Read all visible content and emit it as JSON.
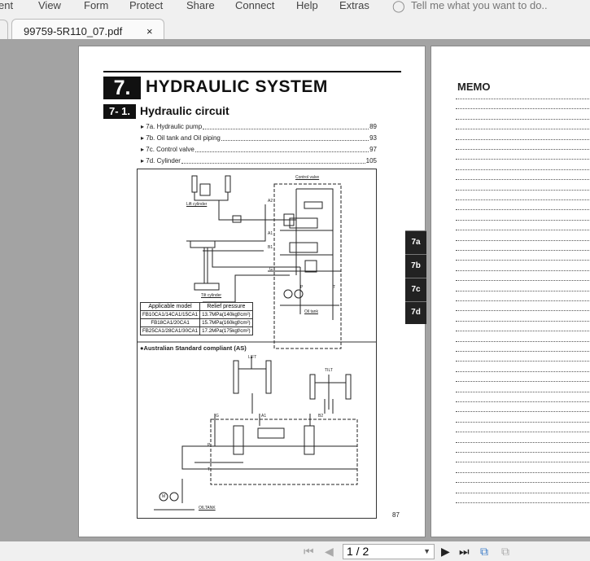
{
  "menubar": {
    "items": [
      "ent",
      "View",
      "Form",
      "Protect",
      "Share",
      "Connect",
      "Help",
      "Extras"
    ],
    "search_placeholder": "Tell me what you want to do.."
  },
  "tabs": [
    {
      "label": "99759-5R110_07.pdf",
      "close": "×"
    }
  ],
  "page1": {
    "chapter_number": "7.",
    "chapter_title": "HYDRAULIC SYSTEM",
    "section_number": "7- 1.",
    "section_title": "Hydraulic circuit",
    "toc": [
      {
        "label": "▸ 7a. Hydraulic pump",
        "page": "89"
      },
      {
        "label": "▸ 7b. Oil tank and Oil piping",
        "page": "93"
      },
      {
        "label": "▸ 7c. Control valve",
        "page": "97"
      },
      {
        "label": "▸ 7d. Cylinder",
        "page": "105"
      }
    ],
    "diagram": {
      "labels": {
        "control_valve": "Control valve",
        "lift_cylinder": "Lift cylinder",
        "tilt_cylinder": "Tilt cylinder",
        "oil_tank": "Oil tank",
        "a2": "A2",
        "a1": "A1",
        "b1": "B1",
        "g": "G",
        "p": "P",
        "t": "T"
      },
      "table": {
        "headers": [
          "Applicable model",
          "Relief pressure"
        ],
        "rows": [
          [
            "FB10CA1/14CA1/15CA1",
            "13.7MPa(140kgf/cm²)"
          ],
          [
            "FB18CA1/20CA1",
            "15.7MPa(160kgf/cm²)"
          ],
          [
            "FB25CA1/28CA1/30CA1",
            "17.2MPa(175kgf/cm²)"
          ]
        ]
      },
      "as_title": "●Australian Standard compliant (AS)",
      "as_labels": {
        "lift": "LIFT",
        "tilt": "TILT",
        "g": "G",
        "a1": "A1",
        "b2": "B2",
        "p": "P",
        "t": "T",
        "oiltank": "OILTANK",
        "m": "M"
      }
    },
    "page_number": "87",
    "side_tabs": [
      "7a",
      "7b",
      "7c",
      "7d"
    ]
  },
  "page2": {
    "title": "MEMO"
  },
  "navigation": {
    "page_indicator": "1 / 2",
    "first": "⏮",
    "prev": "◀",
    "next": "▶",
    "last": "⏭"
  }
}
